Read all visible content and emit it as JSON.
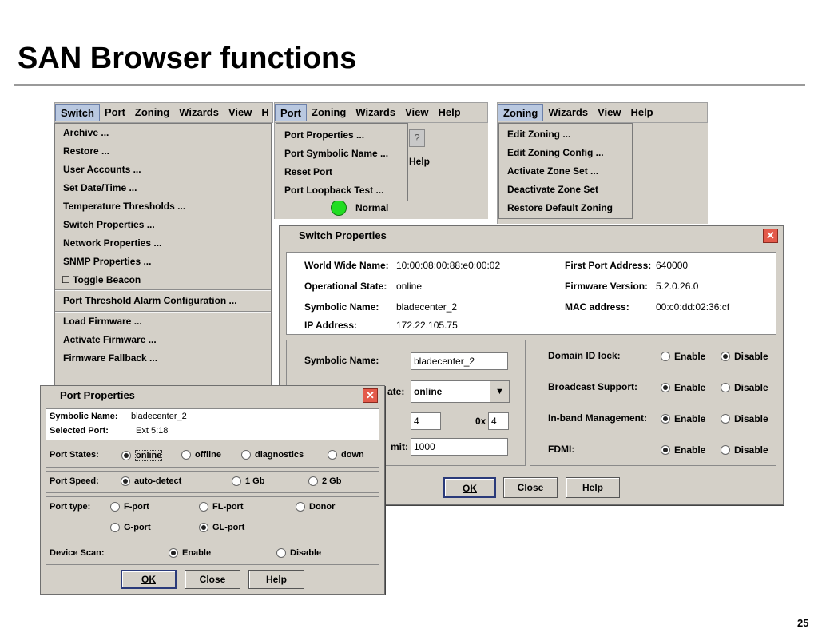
{
  "slide": {
    "title": "SAN Browser functions",
    "page_number": "25"
  },
  "switch_menu": {
    "menubar": [
      "Switch",
      "Port",
      "Zoning",
      "Wizards",
      "View",
      "H"
    ],
    "items": [
      "Archive ...",
      "Restore ...",
      "User Accounts ...",
      "Set Date/Time ...",
      "Temperature Thresholds ...",
      "Switch Properties ...",
      "Network Properties ...",
      "SNMP Properties ...",
      "Toggle Beacon",
      "Port Threshold Alarm Configuration ...",
      "Load Firmware ...",
      "Activate Firmware ...",
      "Firmware Fallback ..."
    ],
    "checkbox_glyph": "☐"
  },
  "port_menu": {
    "menubar": [
      "Port",
      "Zoning",
      "Wizards",
      "View",
      "Help"
    ],
    "items": [
      "Port Properties ...",
      "Port Symbolic Name ...",
      "Reset Port",
      "Port Loopback Test ..."
    ],
    "bg_help": "Help",
    "status": "Normal",
    "help_glyph": "?"
  },
  "zoning_menu": {
    "menubar": [
      "Zoning",
      "Wizards",
      "View",
      "Help"
    ],
    "items": [
      "Edit Zoning ...",
      "Edit Zoning Config ...",
      "Activate Zone Set ...",
      "Deactivate Zone Set",
      "Restore Default Zoning"
    ]
  },
  "switch_properties": {
    "title": "Switch Properties",
    "close_glyph": "✕",
    "info": {
      "wwn_label": "World Wide Name:",
      "wwn": "10:00:08:00:88:e0:00:02",
      "op_state_label": "Operational State:",
      "op_state": "online",
      "symbolic_label": "Symbolic Name:",
      "symbolic": "bladecenter_2",
      "ip_label": "IP Address:",
      "ip": "172.22.105.75",
      "first_port_label": "First Port Address:",
      "first_port": "640000",
      "firmware_label": "Firmware Version:",
      "firmware": "5.2.0.26.0",
      "mac_label": "MAC address:",
      "mac": "00:c0:dd:02:36:cf"
    },
    "edit": {
      "symbolic_label": "Symbolic Name:",
      "symbolic_value": "bladecenter_2",
      "state_label_partial": "ate:",
      "state_value": "online",
      "domain_value": "4",
      "hex_prefix": "0x",
      "hex_value": "4",
      "limit_label_partial": "mit:",
      "limit_value": "1000",
      "arrow_glyph": "▼"
    },
    "options": [
      {
        "label": "Domain ID lock:",
        "enable": "Enable",
        "disable": "Disable",
        "selected": "disable"
      },
      {
        "label": "Broadcast Support:",
        "enable": "Enable",
        "disable": "Disable",
        "selected": "enable"
      },
      {
        "label": "In-band Management:",
        "enable": "Enable",
        "disable": "Disable",
        "selected": "enable"
      },
      {
        "label": "FDMI:",
        "enable": "Enable",
        "disable": "Disable",
        "selected": "enable"
      }
    ],
    "buttons": {
      "ok": "OK",
      "close": "Close",
      "help": "Help"
    }
  },
  "port_properties": {
    "title": "Port Properties",
    "close_glyph": "✕",
    "symbolic_label": "Symbolic Name:",
    "symbolic": "bladecenter_2",
    "selected_label": "Selected Port:",
    "selected": "Ext 5:18",
    "states_label": "Port States:",
    "states": [
      "online",
      "offline",
      "diagnostics",
      "down"
    ],
    "state_selected": "online",
    "speed_label": "Port Speed:",
    "speeds": [
      "auto-detect",
      "1 Gb",
      "2 Gb"
    ],
    "speed_selected": "auto-detect",
    "type_label": "Port type:",
    "types": [
      "F-port",
      "FL-port",
      "Donor",
      "G-port",
      "GL-port"
    ],
    "type_selected": "GL-port",
    "scan_label": "Device Scan:",
    "scan_options": [
      "Enable",
      "Disable"
    ],
    "scan_selected": "Enable",
    "buttons": {
      "ok": "OK",
      "close": "Close",
      "help": "Help"
    }
  }
}
